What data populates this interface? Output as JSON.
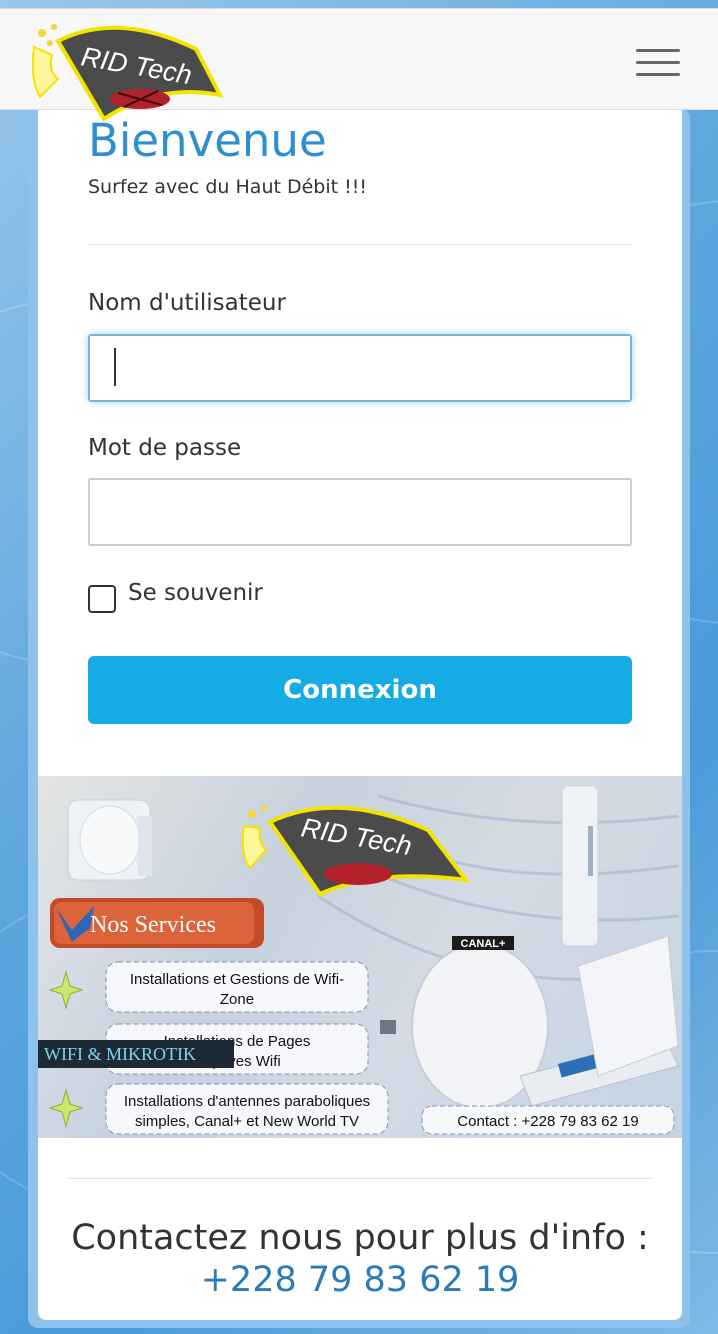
{
  "header": {
    "logo_text": "RID Tech",
    "menu_icon": "hamburger-menu-icon"
  },
  "login": {
    "title": "Bienvenue",
    "subtitle": "Surfez avec du Haut Débit !!!",
    "username_label": "Nom d'utilisateur",
    "username_value": "",
    "password_label": "Mot de passe",
    "password_value": "",
    "remember_label": "Se souvenir",
    "remember_checked": false,
    "submit_label": "Connexion"
  },
  "banner": {
    "logo_text": "RID Tech",
    "services_title": "Nos Services",
    "service_1_line_1": "Installations et Gestions de Wifi-",
    "service_1_line_2": "Zone",
    "service_2_line_1": "Installations de Pages",
    "service_2_line_2": "Captives Wifi",
    "service_3_line_1": "Installations d'antennes paraboliques",
    "service_3_line_2": "simples, Canal+ et New World TV",
    "overlay_tag": "WIFI & MIKROTIK",
    "canal_badge": "CANAL+",
    "contact_line": "Contact : +228 79 83 62 19"
  },
  "footer": {
    "contact_title": "Contactez nous pour plus d'info :",
    "contact_phone": "+228 79 83 62 19"
  },
  "colors": {
    "accent": "#2d8fd0",
    "button": "#15ace6",
    "phone": "#2d7bb6",
    "background": "#5fa8df"
  }
}
